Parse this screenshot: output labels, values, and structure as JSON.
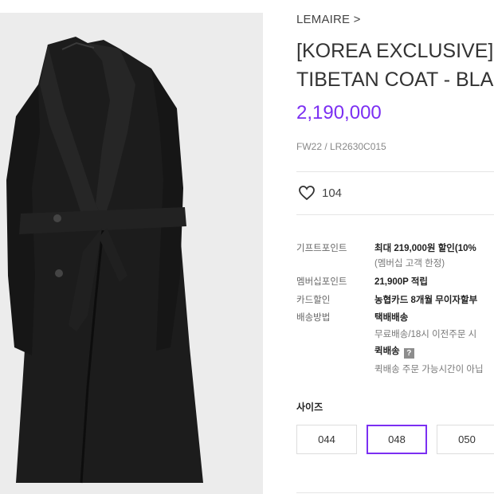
{
  "product": {
    "brand": "LEMAIRE >",
    "title_line1": "[KOREA EXCLUSIVE]",
    "title_line2": "TIBETAN COAT - BLA",
    "price": "2,190,000",
    "code": "FW22 / LR2630C015",
    "likes": "104",
    "image_alt": "black long wool coat with belt"
  },
  "specs": {
    "gift_point_label": "기프트포인트",
    "gift_point_value": "최대 219,000원 할인(10%",
    "gift_point_note": "(멤버십 고객 한정)",
    "member_point_label": "멤버십포인트",
    "member_point_value": "21,900P 적립",
    "card_label": "카드할인",
    "card_value": "농협카드 8개월 무이자할부",
    "shipping_label": "배송방법",
    "shipping_value": "택배배송",
    "shipping_note": "무료배송/18시 이전주문 시",
    "quick_label": "퀵배송",
    "quick_help": "?",
    "quick_note": "퀵배송 주문 가능시간이 아닙"
  },
  "size": {
    "label": "사이즈",
    "options": [
      "044",
      "048",
      "050"
    ],
    "selected": "048"
  },
  "colors": {
    "accent": "#7b2ff2",
    "image_bg": "#ececec"
  }
}
